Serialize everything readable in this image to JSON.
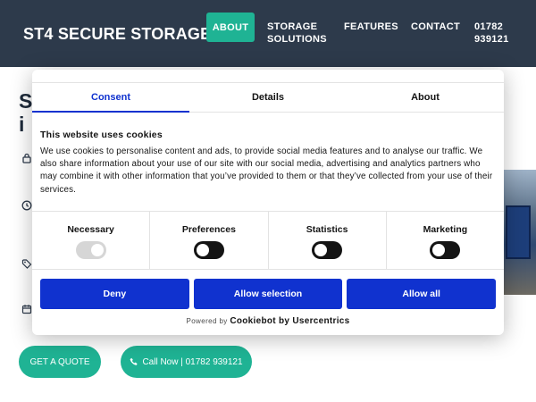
{
  "header": {
    "logo": "ST4 SECURE STORAGE",
    "nav": {
      "about": "ABOUT",
      "storage": "STORAGE SOLUTIONS",
      "features": "FEATURES",
      "contact": "CONTACT",
      "phone": "01782 939121"
    }
  },
  "page": {
    "heading_fragment": "S\ni",
    "cta_quote": "GET A QUOTE",
    "cta_call": "Call Now | 01782 939121"
  },
  "cookie": {
    "tabs": {
      "consent": "Consent",
      "details": "Details",
      "about": "About"
    },
    "title": "This website uses cookies",
    "body": "We use cookies to personalise content and ads, to provide social media features and to analyse our traffic. We also share information about your use of our site with our social media, advertising and analytics partners who may combine it with other information that you’ve provided to them or that they’ve collected from your use of their services.",
    "categories": {
      "necessary": "Necessary",
      "preferences": "Preferences",
      "statistics": "Statistics",
      "marketing": "Marketing"
    },
    "buttons": {
      "deny": "Deny",
      "allow_selection": "Allow selection",
      "allow_all": "Allow all"
    },
    "powered_by": "Powered by",
    "powered_brand": "Cookiebot by Usercentrics"
  },
  "colors": {
    "header_bg": "#2d3a4b",
    "accent": "#1fb394",
    "cookie_blue": "#1032cf"
  }
}
